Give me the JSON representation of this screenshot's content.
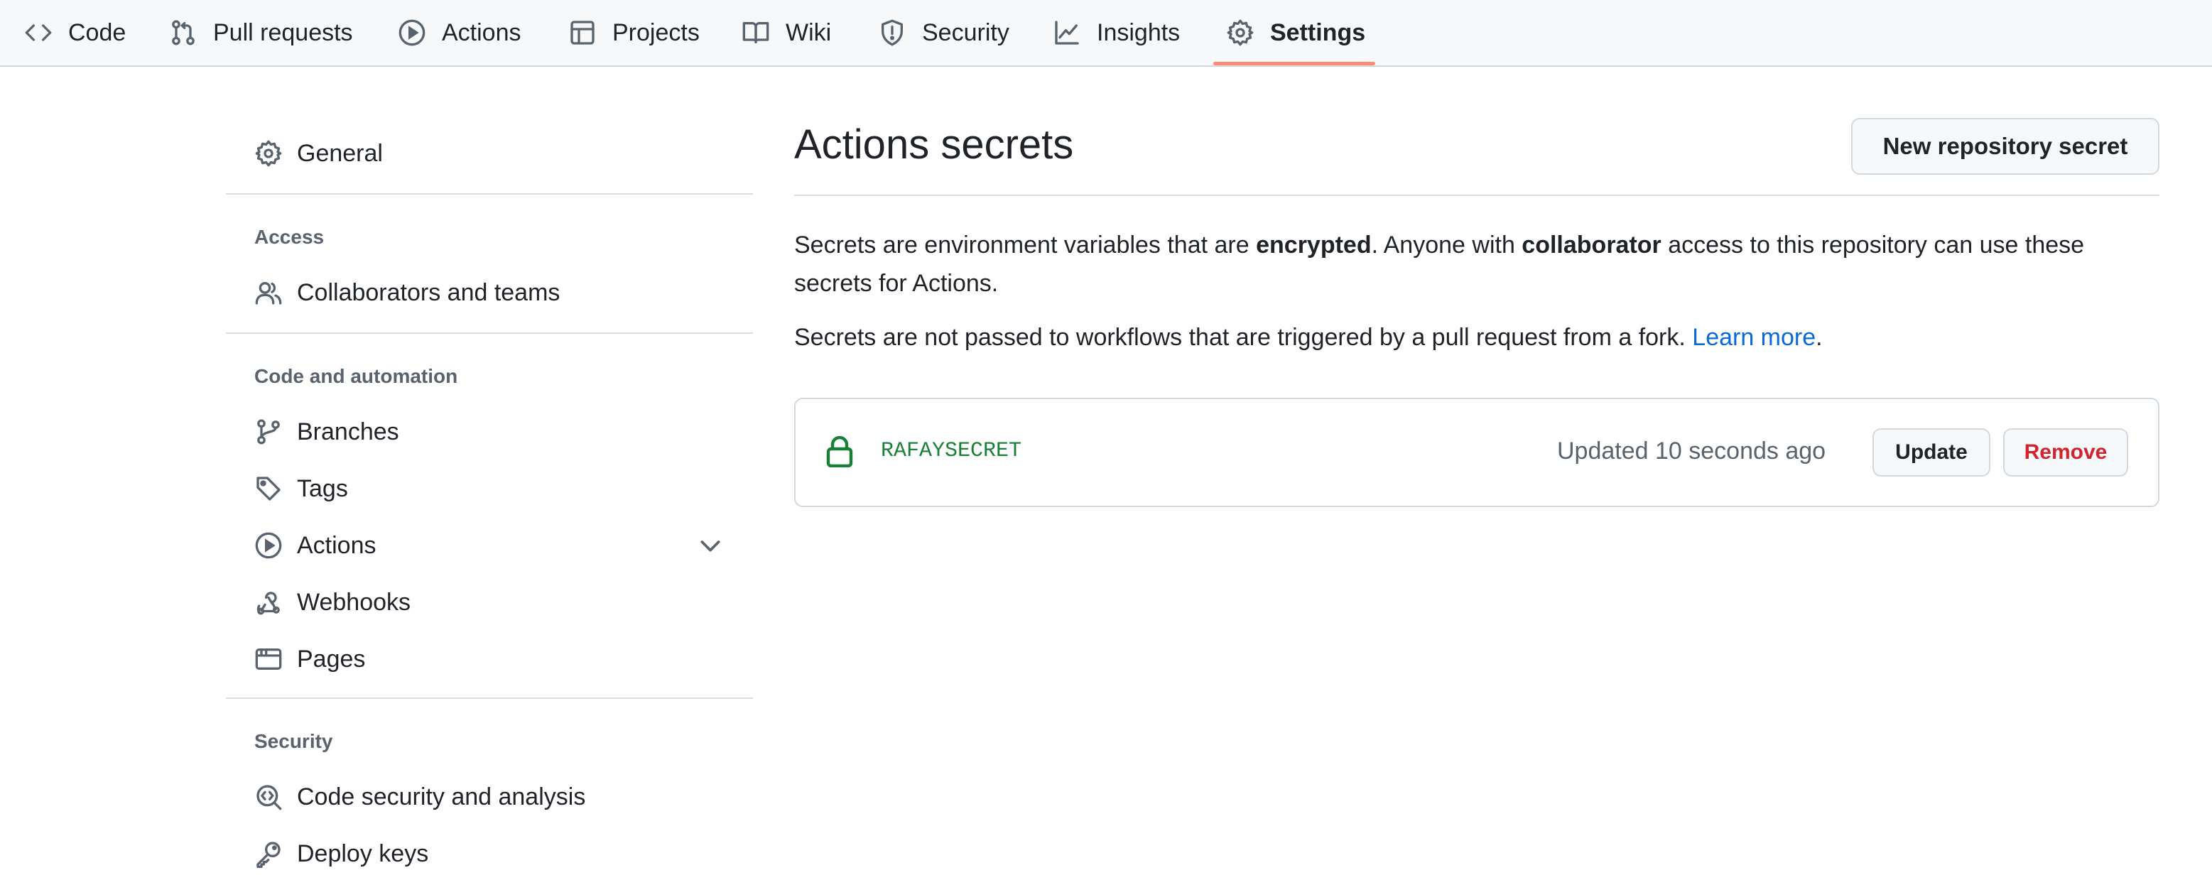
{
  "repo_nav": {
    "tabs": [
      {
        "label": "Code",
        "icon": "code-icon"
      },
      {
        "label": "Pull requests",
        "icon": "git-pull-request-icon"
      },
      {
        "label": "Actions",
        "icon": "play-icon"
      },
      {
        "label": "Projects",
        "icon": "table-icon"
      },
      {
        "label": "Wiki",
        "icon": "book-icon"
      },
      {
        "label": "Security",
        "icon": "shield-icon"
      },
      {
        "label": "Insights",
        "icon": "graph-icon"
      },
      {
        "label": "Settings",
        "icon": "gear-icon",
        "active": true
      }
    ],
    "active_underline_color": "#fd8c73"
  },
  "sidebar": {
    "general": "General",
    "access_heading": "Access",
    "collaborators": "Collaborators and teams",
    "code_automation_heading": "Code and automation",
    "branches": "Branches",
    "tags": "Tags",
    "actions": "Actions",
    "webhooks": "Webhooks",
    "pages": "Pages",
    "security_heading": "Security",
    "code_security": "Code security and analysis",
    "deploy_keys": "Deploy keys"
  },
  "main": {
    "title": "Actions secrets",
    "new_secret_button": "New repository secret",
    "description": {
      "part1": "Secrets are environment variables that are ",
      "bold1": "encrypted",
      "part2": ". Anyone with ",
      "bold2": "collaborator",
      "part3": " access to this repository can use these secrets for Actions."
    },
    "fork_note": {
      "text": "Secrets are not passed to workflows that are triggered by a pull request from a fork. ",
      "link": "Learn more",
      "end": "."
    },
    "secrets": [
      {
        "name": "RAFAYSECRET",
        "updated": "Updated 10 seconds ago",
        "update_label": "Update",
        "remove_label": "Remove"
      }
    ]
  },
  "colors": {
    "link": "#0969da",
    "secret_name": "#1a7f37",
    "danger": "#d1242f",
    "muted": "#59636e"
  }
}
